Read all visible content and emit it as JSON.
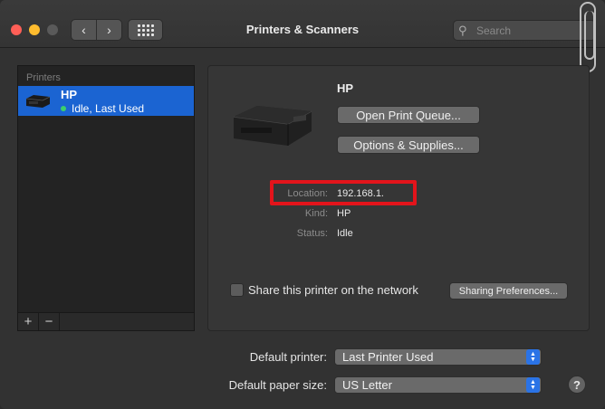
{
  "window": {
    "title": "Printers & Scanners",
    "search_placeholder": "Search",
    "nav_back": "‹",
    "nav_forward": "›"
  },
  "printer_list": {
    "header": "Printers",
    "items": [
      {
        "name": "HP",
        "status": "Idle, Last Used",
        "selected": true,
        "status_color": "#3bd06c"
      }
    ],
    "add_label": "+",
    "remove_label": "−"
  },
  "detail": {
    "name": "HP",
    "open_queue_label": "Open Print Queue...",
    "options_label": "Options & Supplies...",
    "location_label": "Location:",
    "location_value": "192.168.1.",
    "kind_label": "Kind:",
    "kind_value": "HP",
    "status_label": "Status:",
    "status_value": "Idle",
    "share_label": "Share this printer on the network",
    "share_checked": false,
    "sharing_prefs_label": "Sharing Preferences..."
  },
  "preferences": {
    "default_printer_label": "Default printer:",
    "default_printer_value": "Last Printer Used",
    "paper_size_label": "Default paper size:",
    "paper_size_value": "US Letter"
  },
  "colors": {
    "selection": "#1b64d2",
    "highlight_box": "#e3141b",
    "popup_arrow": "#2a73e6"
  }
}
